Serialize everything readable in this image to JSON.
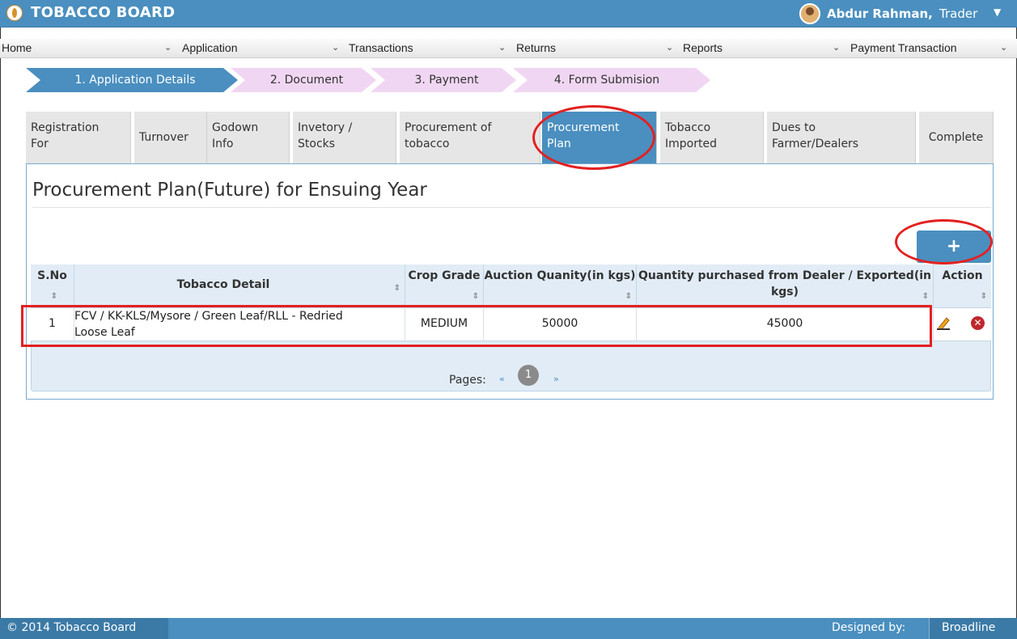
{
  "header": {
    "title": "TOBACCO BOARD",
    "user_name": "Abdur Rahman,",
    "user_role": "Trader"
  },
  "menu": [
    {
      "label": "Home"
    },
    {
      "label": "Application"
    },
    {
      "label": "Transactions"
    },
    {
      "label": "Returns"
    },
    {
      "label": "Reports"
    },
    {
      "label": "Payment Transaction"
    }
  ],
  "steps": [
    {
      "label": "1. Application Details",
      "state": "current"
    },
    {
      "label": "2. Document",
      "state": "pending"
    },
    {
      "label": "3. Payment",
      "state": "pending"
    },
    {
      "label": "4. Form Submision",
      "state": "pending"
    }
  ],
  "tabs": [
    {
      "line1": "Registration",
      "line2": "For"
    },
    {
      "line1": "Turnover",
      "line2": ""
    },
    {
      "line1": "Godown",
      "line2": "Info"
    },
    {
      "line1": "Invetory /",
      "line2": "Stocks"
    },
    {
      "line1": "Procurement of",
      "line2": "tobacco"
    },
    {
      "line1": "Procurement",
      "line2": "Plan",
      "active": true
    },
    {
      "line1": "Tobacco",
      "line2": "Imported"
    },
    {
      "line1": "Dues to",
      "line2": "Farmer/Dealers"
    },
    {
      "line1": "Complete",
      "line2": ""
    }
  ],
  "section": {
    "title": "Procurement Plan(Future) for Ensuing Year",
    "add_button": "+"
  },
  "table": {
    "columns": [
      "S.No",
      "Tobacco Detail",
      "Crop Grade",
      "Auction Quanity(in kgs)",
      "Quantity purchased from Dealer / Exported(in kgs)",
      "Action"
    ],
    "col_h1": "Quantity purchased from Dealer / Exported(in",
    "col_h2": "kgs)",
    "rows": [
      {
        "sno": "1",
        "detail_line1": "FCV / KK-KLS/Mysore / Green Leaf/RLL - Redried",
        "detail_line2": "Loose Leaf",
        "crop_grade": "MEDIUM",
        "auction_qty": "50000",
        "dealer_qty": "45000"
      }
    ]
  },
  "pagination": {
    "label": "Pages:",
    "prev": "«",
    "current": "1",
    "next": "»"
  },
  "footer": {
    "copyright": "© 2014 Tobacco Board",
    "designed_by": "Designed by:",
    "brand": "Broadline"
  },
  "colors": {
    "primary": "#4a8fbf",
    "step_pending": "#f0d6f2",
    "annotation": "#e32020",
    "delete": "#c0272d"
  },
  "icons": [
    "logo-icon",
    "user-avatar-icon",
    "chevron-down-icon",
    "plus-icon",
    "sort-icon",
    "edit-pencil-icon",
    "delete-icon"
  ]
}
